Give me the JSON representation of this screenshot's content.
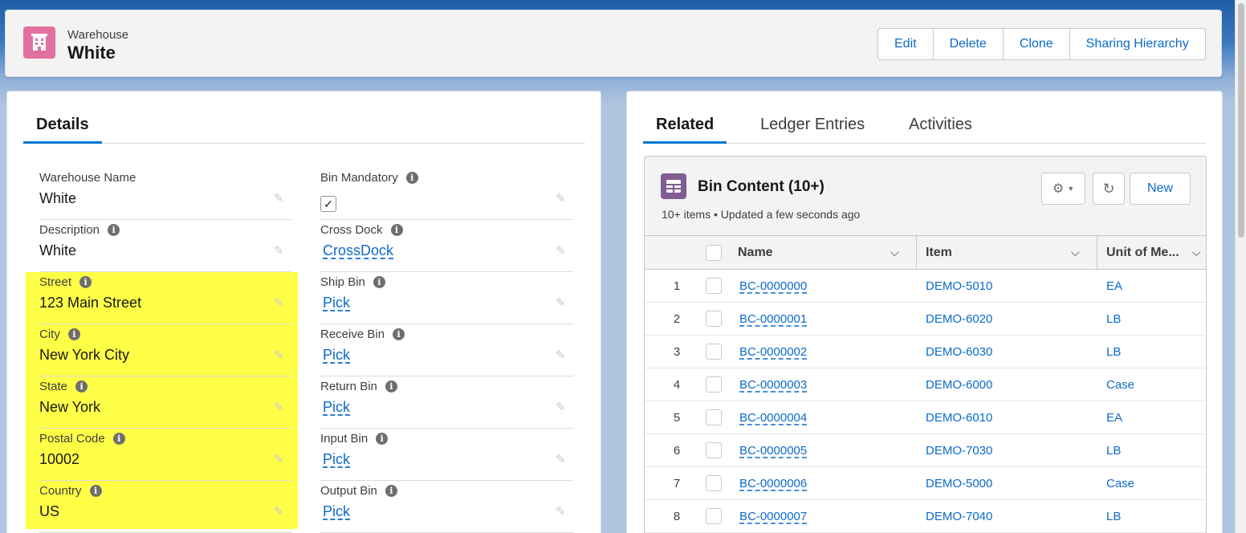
{
  "header": {
    "object_type": "Warehouse",
    "record_name": "White",
    "buttons": [
      "Edit",
      "Delete",
      "Clone",
      "Sharing Hierarchy"
    ]
  },
  "left_panel": {
    "tab": "Details",
    "left_fields": [
      {
        "label": "Warehouse Name",
        "value": "White",
        "info": false
      },
      {
        "label": "Description",
        "value": "White",
        "info": true
      },
      {
        "label": "Street",
        "value": "123 Main Street",
        "info": true
      },
      {
        "label": "City",
        "value": "New York City",
        "info": true
      },
      {
        "label": "State",
        "value": "New York",
        "info": true
      },
      {
        "label": "Postal Code",
        "value": "10002",
        "info": true
      },
      {
        "label": "Country",
        "value": "US",
        "info": true
      }
    ],
    "right_fields": [
      {
        "label": "Bin Mandatory",
        "value": "✓",
        "type": "checkbox",
        "checked": true
      },
      {
        "label": "Cross Dock",
        "value": "CrossDock",
        "type": "link"
      },
      {
        "label": "Ship Bin",
        "value": "Pick",
        "type": "link"
      },
      {
        "label": "Receive Bin",
        "value": "Pick",
        "type": "link"
      },
      {
        "label": "Return Bin",
        "value": "Pick",
        "type": "link"
      },
      {
        "label": "Input Bin",
        "value": "Pick",
        "type": "link"
      },
      {
        "label": "Output Bin",
        "value": "Pick",
        "type": "link"
      }
    ],
    "highlight_color": "#ffff47"
  },
  "right_panel": {
    "tabs": [
      "Related",
      "Ledger Entries",
      "Activities"
    ],
    "active_tab": "Related",
    "related_list": {
      "title": "Bin Content (10+)",
      "subtitle": "10+ items • Updated a few seconds ago",
      "new_label": "New",
      "columns": [
        "Name",
        "Item",
        "Unit of Me..."
      ],
      "rows": [
        {
          "num": "1",
          "name": "BC-0000000",
          "item": "DEMO-5010",
          "unit": "EA"
        },
        {
          "num": "2",
          "name": "BC-0000001",
          "item": "DEMO-6020",
          "unit": "LB"
        },
        {
          "num": "3",
          "name": "BC-0000002",
          "item": "DEMO-6030",
          "unit": "LB"
        },
        {
          "num": "4",
          "name": "BC-0000003",
          "item": "DEMO-6000",
          "unit": "Case"
        },
        {
          "num": "5",
          "name": "BC-0000004",
          "item": "DEMO-6010",
          "unit": "EA"
        },
        {
          "num": "6",
          "name": "BC-0000005",
          "item": "DEMO-7030",
          "unit": "LB"
        },
        {
          "num": "7",
          "name": "BC-0000006",
          "item": "DEMO-5000",
          "unit": "Case"
        },
        {
          "num": "8",
          "name": "BC-0000007",
          "item": "DEMO-7040",
          "unit": "LB"
        }
      ]
    }
  },
  "colors": {
    "accent": "#0176d3",
    "link": "#0b6bcb",
    "warehouse_icon": "#e3719f",
    "bin_icon": "#7f5d92"
  },
  "icons": {
    "warehouse": "building-icon",
    "related": "table-icon",
    "settings": "gear-icon",
    "refresh": "refresh-icon",
    "edit": "pencil-icon",
    "info": "info-icon"
  }
}
